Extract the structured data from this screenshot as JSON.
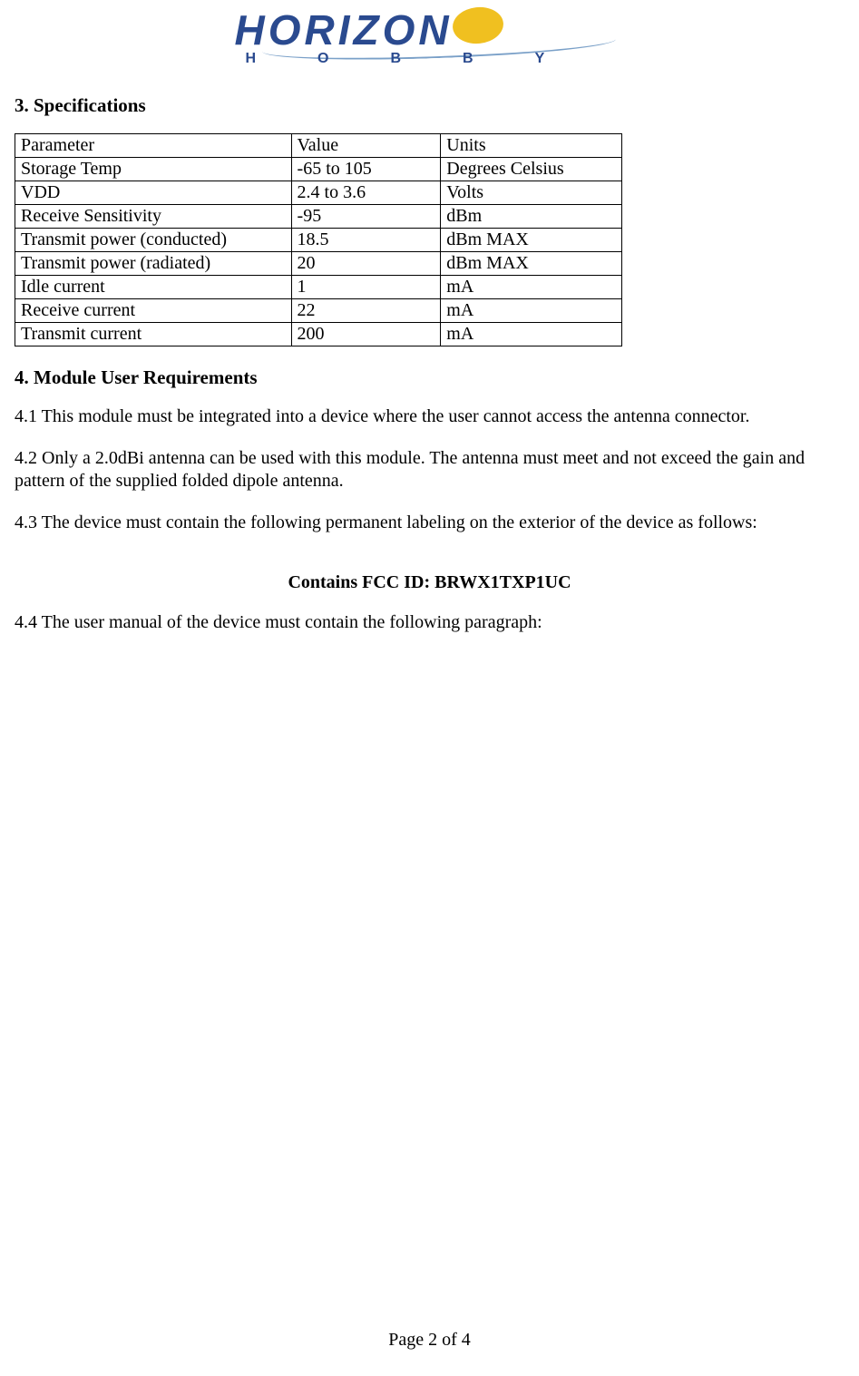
{
  "logo": {
    "word": "HORIZON",
    "sub": "HOBBY"
  },
  "sections": {
    "spec_heading": "3. Specifications",
    "req_heading": "4. Module User Requirements"
  },
  "table": {
    "headers": {
      "param": "Parameter",
      "value": "Value",
      "units": "Units"
    },
    "rows": [
      {
        "param": "Storage Temp",
        "value": "-65 to 105",
        "units": "Degrees Celsius"
      },
      {
        "param": "VDD",
        "value": "2.4 to 3.6",
        "units": "Volts"
      },
      {
        "param": "Receive Sensitivity",
        "value": "-95",
        "units": "dBm"
      },
      {
        "param": "Transmit power (conducted)",
        "value": "18.5",
        "units": "dBm MAX"
      },
      {
        "param": "Transmit power (radiated)",
        "value": "20",
        "units": "dBm MAX"
      },
      {
        "param": "Idle current",
        "value": "1",
        "units": "mA"
      },
      {
        "param": "Receive current",
        "value": "22",
        "units": "mA"
      },
      {
        "param": "Transmit current",
        "value": "200",
        "units": "mA"
      }
    ]
  },
  "paras": {
    "p41": "4.1 This module must be integrated into a device where the user cannot access the antenna connector.",
    "p42": "4.2 Only a 2.0dBi antenna can be used with this module. The antenna must meet and not exceed the gain and pattern of the supplied folded dipole antenna.",
    "p43": "4.3 The device must contain the following permanent labeling on the exterior of the device as follows:",
    "fcc": "Contains FCC ID: BRWX1TXP1UC",
    "p44": "4.4 The user manual of the device must contain the following paragraph:"
  },
  "footer": "Page 2 of 4"
}
